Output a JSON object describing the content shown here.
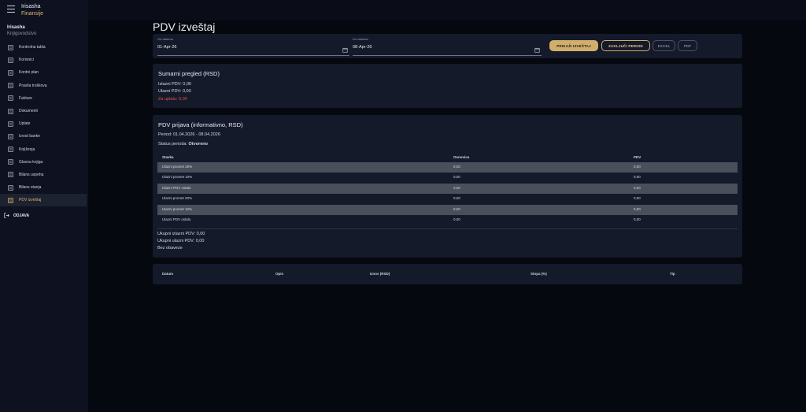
{
  "app": {
    "brand_line1": "Irisasha",
    "brand_line2": "Finansije"
  },
  "user": {
    "name": "Irisasha",
    "role": "Knjigovodstvo"
  },
  "sidebar": {
    "items": [
      {
        "label": "Kontrolna tabla",
        "icon": "dashboard-icon"
      },
      {
        "label": "Korisnici",
        "icon": "users-icon"
      },
      {
        "label": "Kontni plan",
        "icon": "account-tree-icon"
      },
      {
        "label": "Pravila troškova",
        "icon": "rules-icon"
      },
      {
        "label": "Fakture",
        "icon": "invoice-icon"
      },
      {
        "label": "Dokumenti",
        "icon": "document-icon"
      },
      {
        "label": "Uplate",
        "icon": "payment-icon"
      },
      {
        "label": "Izvod banke",
        "icon": "bank-statement-icon"
      },
      {
        "label": "Knjiženja",
        "icon": "journal-icon"
      },
      {
        "label": "Glavna knjiga",
        "icon": "ledger-icon"
      },
      {
        "label": "Bilans uspeha",
        "icon": "bar-chart-icon"
      },
      {
        "label": "Bilans stanja",
        "icon": "balance-icon"
      },
      {
        "label": "PDV izveštaj",
        "icon": "report-icon"
      }
    ],
    "logout": "ODJAVA"
  },
  "page": {
    "title": "PDV izveštaj"
  },
  "filter": {
    "from_label": "Od datuma",
    "from_value": "01-Apr-26",
    "to_label": "Do datuma",
    "to_value": "08-Apr-26",
    "show_button": "PRIKAŽI IZVEŠTAJ",
    "close_button": "ZAKLJUČI PERIOD",
    "excel_button": "EXCEL",
    "pdf_button": "PDF"
  },
  "summary": {
    "title": "Sumarni pregled (RSD)",
    "out_vat": "Izlazni PDV: 0,00",
    "in_vat": "Ulazni PDV: 0,00",
    "to_pay": "Za uplatu: 0,00"
  },
  "return": {
    "title": "PDV prijava (informativno, RSD)",
    "period": "Period: 01.04.2026 - 08.04.2026",
    "status_label": "Status perioda: ",
    "status_value": "Otvoreno",
    "columns": [
      "Stavka",
      "Osnovica",
      "PDV"
    ],
    "rows": [
      [
        "Izlazni promet 20%",
        "0,00",
        "0,00"
      ],
      [
        "Izlazni promet 10%",
        "0,00",
        "0,00"
      ],
      [
        "Izlazni PDV ostalo",
        "0,00",
        "0,00"
      ],
      [
        "Ulazni promet 20%",
        "0,00",
        "0,00"
      ],
      [
        "Ulazni promet 10%",
        "0,00",
        "0,00"
      ],
      [
        "Ulazni PDV ostalo",
        "0,00",
        "0,00"
      ]
    ],
    "total_out": "Ukupni izlazni PDV: 0,00",
    "total_in": "Ukupni ulazni PDV: 0,00",
    "obligation": "Bez obaveze"
  },
  "detail": {
    "columns": [
      "Datum",
      "Opis",
      "Iznos (RSD)",
      "Stopa (%)",
      "Tip"
    ]
  }
}
